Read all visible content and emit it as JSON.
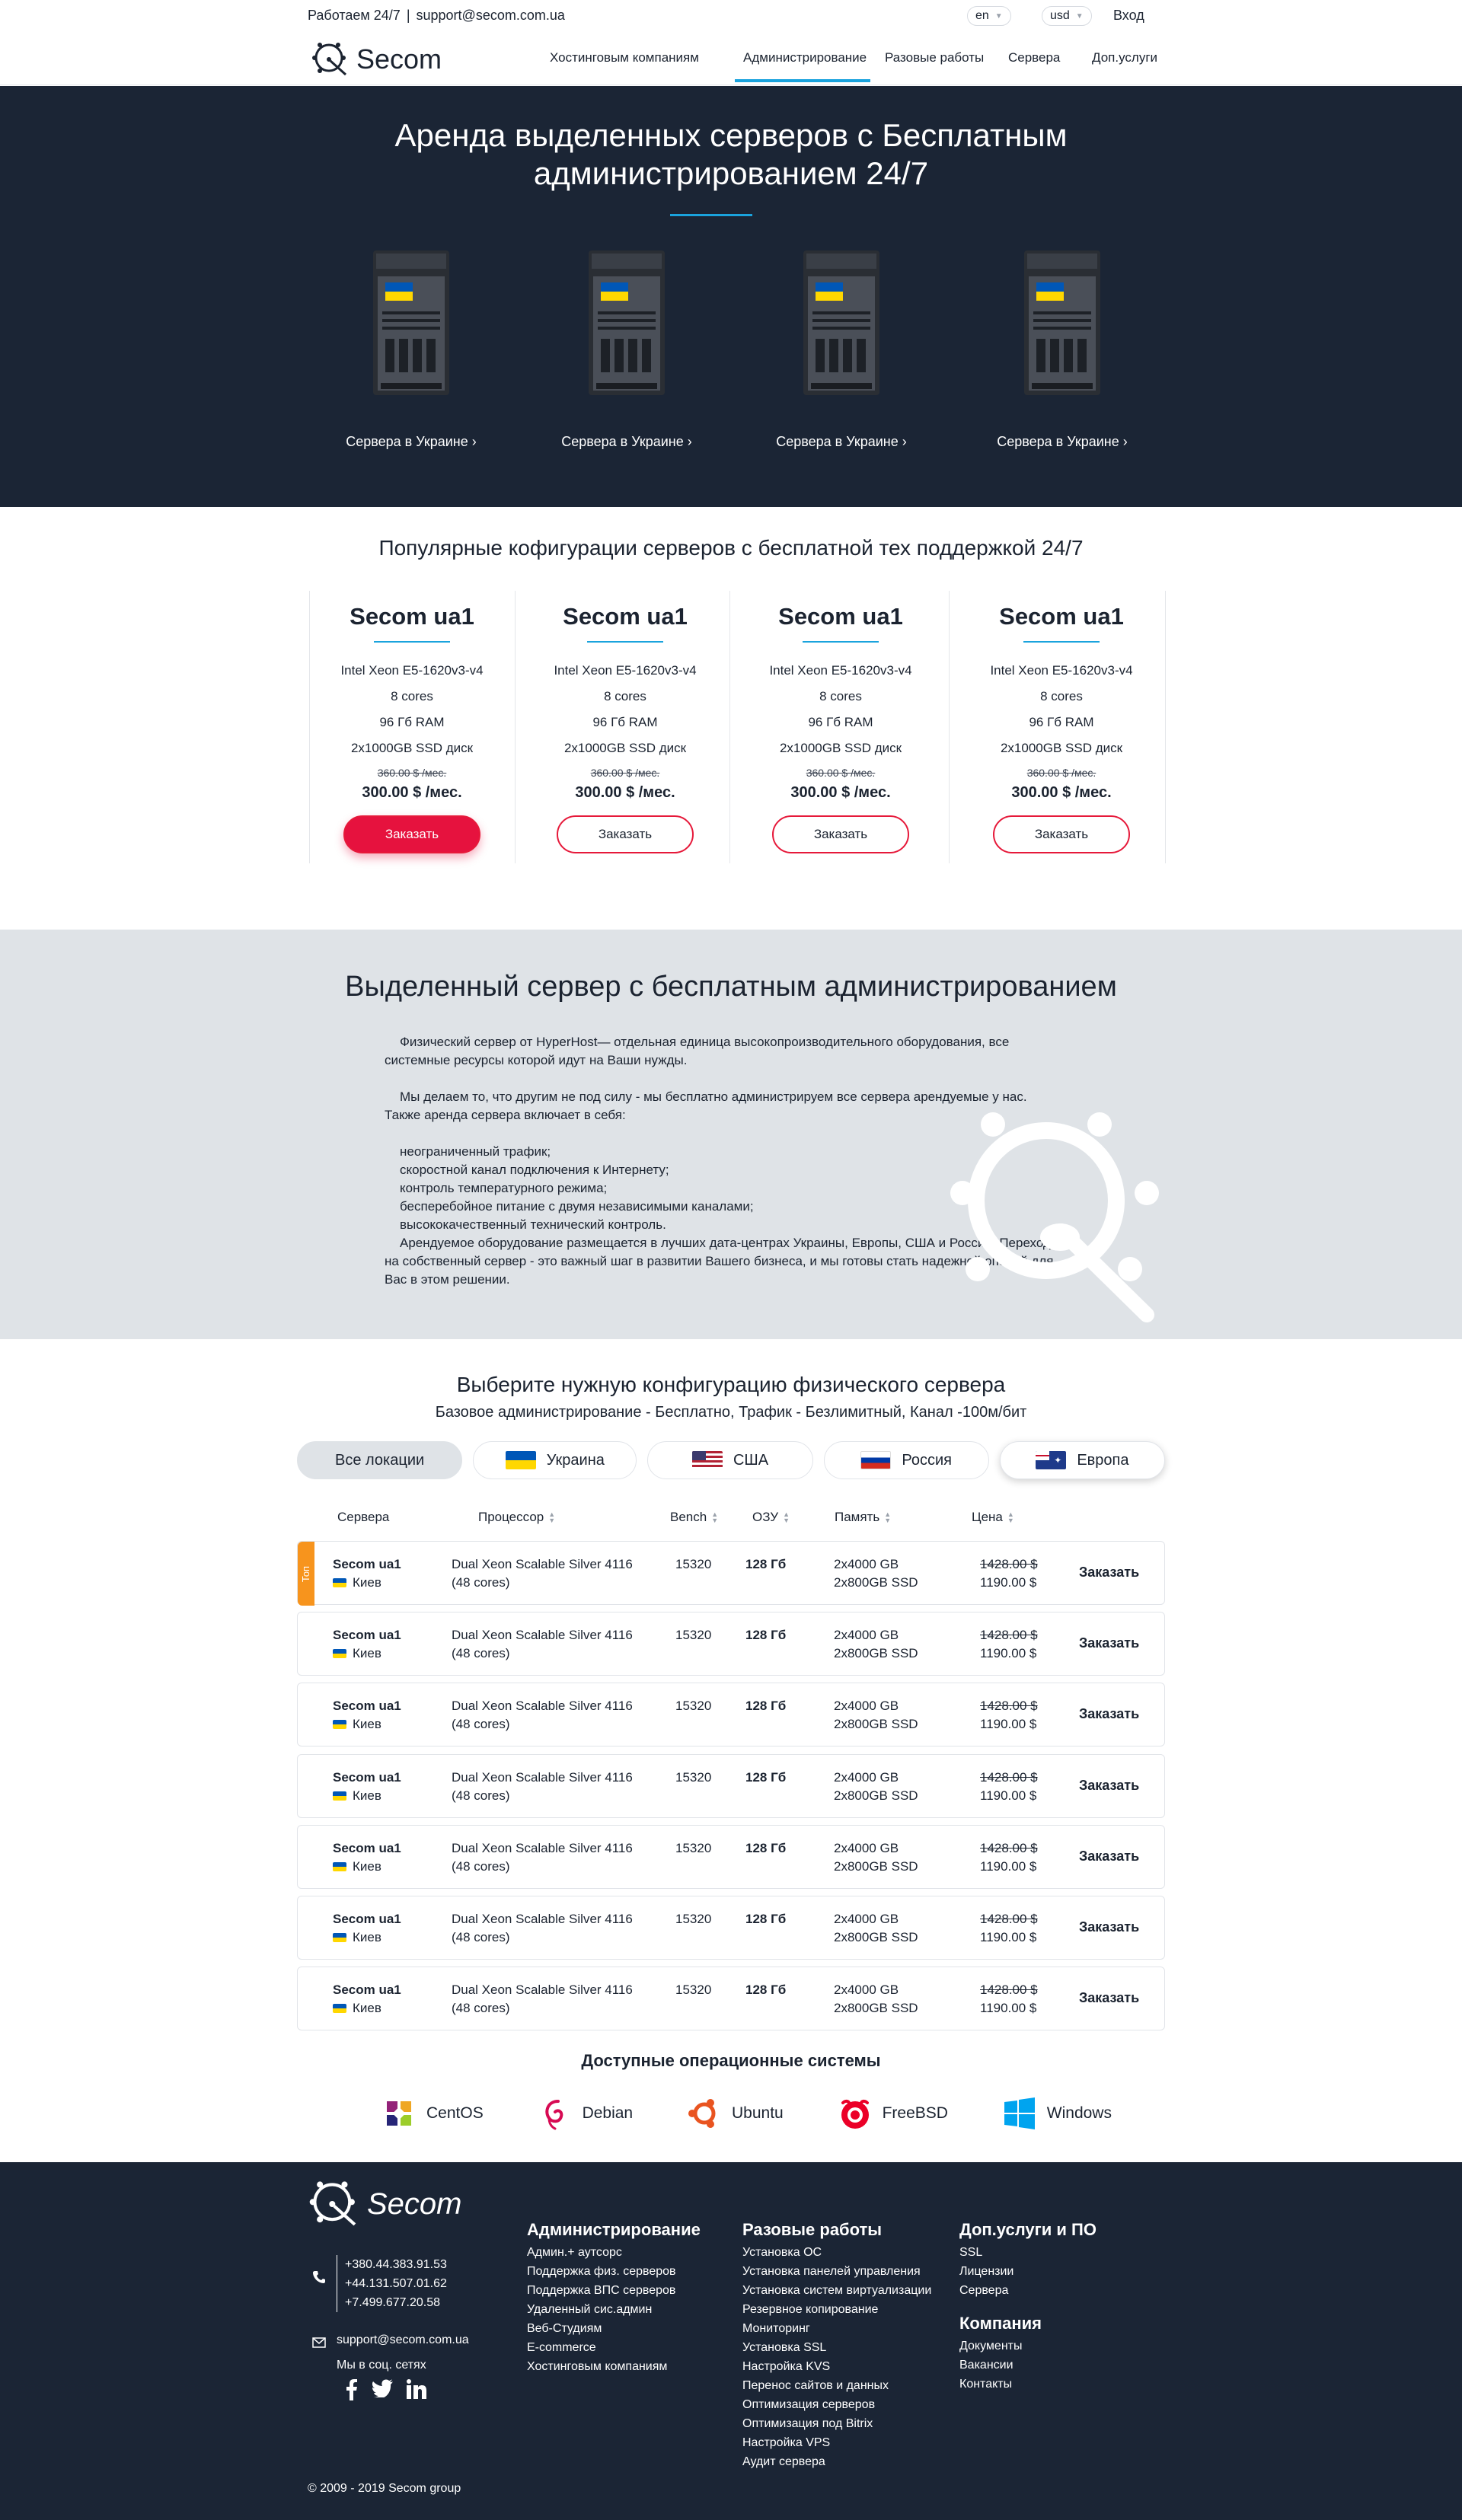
{
  "topbar": {
    "hours": "Работаем 24/7",
    "separator": "|",
    "email": "support@secom.com.ua",
    "lang": "en",
    "currency": "usd",
    "login": "Вход"
  },
  "brand": {
    "name": "Secom",
    "accent": "#1aa3dd",
    "danger": "#e6123e",
    "dark": "#1b2535"
  },
  "nav": {
    "items": [
      "Хостинговым компаниям",
      "Администрирование",
      "Разовые работы",
      "Сервера",
      "Доп.услуги"
    ],
    "active_index": 1
  },
  "hero": {
    "title_line1": "Аренда выделенных серверов с Бесплатным",
    "title_line2": "администрированием 24/7",
    "cards": [
      {
        "label": "Сервера в Украине ›"
      },
      {
        "label": "Сервера в Украине ›"
      },
      {
        "label": "Сервера в Украине ›"
      },
      {
        "label": "Сервера в Украине ›"
      }
    ]
  },
  "popular": {
    "title": "Популярные кофигурации серверов с бесплатной тех поддержкой 24/7",
    "plans": [
      {
        "name": "Secom ua1",
        "cpu": "Intel Xeon E5-1620v3-v4",
        "cores": "8 cores",
        "ram": "96 Гб RAM",
        "disk": "2x1000GB SSD диск",
        "old_price": "360.00 $ /мес.",
        "price": "300.00 $ /мес.",
        "button": "Заказать"
      },
      {
        "name": "Secom ua1",
        "cpu": "Intel Xeon E5-1620v3-v4",
        "cores": "8 cores",
        "ram": "96 Гб RAM",
        "disk": "2x1000GB SSD диск",
        "old_price": "360.00 $ /мес.",
        "price": "300.00 $ /мес.",
        "button": "Заказать"
      },
      {
        "name": "Secom ua1",
        "cpu": "Intel Xeon E5-1620v3-v4",
        "cores": "8 cores",
        "ram": "96 Гб RAM",
        "disk": "2x1000GB SSD диск",
        "old_price": "360.00 $ /мес.",
        "price": "300.00 $ /мес.",
        "button": "Заказать"
      },
      {
        "name": "Secom ua1",
        "cpu": "Intel Xeon E5-1620v3-v4",
        "cores": "8 cores",
        "ram": "96 Гб RAM",
        "disk": "2x1000GB SSD диск",
        "old_price": "360.00 $ /мес.",
        "price": "300.00 $ /мес.",
        "button": "Заказать"
      }
    ]
  },
  "info": {
    "title": "Выделенный сервер с бесплатным администрированием",
    "p1": "Физический сервер от HyperHost— отдельная единица высокопроизводительного оборудования, все системные ресурсы которой идут на Ваши нужды.",
    "p2": "Мы делаем то, что другим не под силу - мы бесплатно администрируем все сервера арендуемые у нас. Также аренда сервера включает в себя:",
    "list": [
      "неограниченный трафик;",
      "скоростной канал подключения к Интернету;",
      "контроль температурного режима;",
      "бесперебойное питание с двумя независимыми каналами;",
      "высококачественный технический контроль."
    ],
    "p3": "Арендуемое оборудование размещается в лучших дата-центрах Украины, Европы, США и России. Переход на собственный сервер - это важный шаг в развитии Вашего бизнеса, и мы готовы стать надежной опорой для Вас в этом решении."
  },
  "selector": {
    "title": "Выберите нужную конфигурацию физического сервера",
    "subtitle": "Базовое администрирование - Бесплатно, Трафик - Безлимитный, Канал -100м/бит",
    "locations": [
      {
        "label": "Все локации",
        "flag": ""
      },
      {
        "label": "Украина",
        "flag": "ua"
      },
      {
        "label": "США",
        "flag": "us"
      },
      {
        "label": "Россия",
        "flag": "ru"
      },
      {
        "label": "Европа",
        "flag": "eu"
      }
    ],
    "columns": [
      "Сервера",
      "Процессор",
      "Bench",
      "ОЗУ",
      "Память",
      "Цена"
    ],
    "badge": "Топ",
    "rows": [
      {
        "name": "Secom ua1",
        "city": "Киев",
        "cpu1": "Dual Xeon Scalable Silver 4116",
        "cpu2": "(48 cores)",
        "bench": "15320",
        "ram": "128 Гб",
        "disk1": "2x4000 GB",
        "disk2": "2x800GB SSD",
        "old": "1428.00 $",
        "price": "1190.00 $",
        "order": "Заказать"
      },
      {
        "name": "Secom ua1",
        "city": "Киев",
        "cpu1": "Dual Xeon Scalable Silver 4116",
        "cpu2": "(48 cores)",
        "bench": "15320",
        "ram": "128 Гб",
        "disk1": "2x4000 GB",
        "disk2": "2x800GB SSD",
        "old": "1428.00 $",
        "price": "1190.00 $",
        "order": "Заказать"
      },
      {
        "name": "Secom ua1",
        "city": "Киев",
        "cpu1": "Dual Xeon Scalable Silver 4116",
        "cpu2": "(48 cores)",
        "bench": "15320",
        "ram": "128 Гб",
        "disk1": "2x4000 GB",
        "disk2": "2x800GB SSD",
        "old": "1428.00 $",
        "price": "1190.00 $",
        "order": "Заказать"
      },
      {
        "name": "Secom ua1",
        "city": "Киев",
        "cpu1": "Dual Xeon Scalable Silver 4116",
        "cpu2": "(48 cores)",
        "bench": "15320",
        "ram": "128 Гб",
        "disk1": "2x4000 GB",
        "disk2": "2x800GB SSD",
        "old": "1428.00 $",
        "price": "1190.00 $",
        "order": "Заказать"
      },
      {
        "name": "Secom ua1",
        "city": "Киев",
        "cpu1": "Dual Xeon Scalable Silver 4116",
        "cpu2": "(48 cores)",
        "bench": "15320",
        "ram": "128 Гб",
        "disk1": "2x4000 GB",
        "disk2": "2x800GB SSD",
        "old": "1428.00 $",
        "price": "1190.00 $",
        "order": "Заказать"
      },
      {
        "name": "Secom ua1",
        "city": "Киев",
        "cpu1": "Dual Xeon Scalable Silver 4116",
        "cpu2": "(48 cores)",
        "bench": "15320",
        "ram": "128 Гб",
        "disk1": "2x4000 GB",
        "disk2": "2x800GB SSD",
        "old": "1428.00 $",
        "price": "1190.00 $",
        "order": "Заказать"
      },
      {
        "name": "Secom ua1",
        "city": "Киев",
        "cpu1": "Dual Xeon Scalable Silver 4116",
        "cpu2": "(48 cores)",
        "bench": "15320",
        "ram": "128 Гб",
        "disk1": "2x4000 GB",
        "disk2": "2x800GB SSD",
        "old": "1428.00 $",
        "price": "1190.00 $",
        "order": "Заказать"
      }
    ]
  },
  "os": {
    "title": "Доступные операционные системы",
    "items": [
      {
        "label": "CentOS",
        "icon": "centos-icon"
      },
      {
        "label": "Debian",
        "icon": "debian-icon"
      },
      {
        "label": "Ubuntu",
        "icon": "ubuntu-icon"
      },
      {
        "label": "FreeBSD",
        "icon": "freebsd-icon"
      },
      {
        "label": "Windows",
        "icon": "windows-icon"
      }
    ]
  },
  "footer": {
    "phones": [
      "+380.44.383.91.53",
      "+44.131.507.01.62",
      "+7.499.677.20.58"
    ],
    "email": "support@secom.com.ua",
    "social_label": "Мы в соц. сетях",
    "col1": {
      "title": "Администрирование",
      "items": [
        "Админ.+ аутсорс",
        "Поддержка физ. серверов",
        "Поддержка ВПС серверов",
        "Удаленный сис.админ",
        "Веб-Студиям",
        "E-commerce",
        "Хостинговым компаниям"
      ]
    },
    "col2": {
      "title": "Разовые работы",
      "items": [
        "Установка ОС",
        "Установка панелей управления",
        "Установка систем виртуализации",
        "Резервное копирование",
        "Мониторинг",
        "Установка SSL",
        "Настройка KVS",
        "Перенос сайтов и данных",
        "Оптимизация серверов",
        "Оптимизация под Bitrix",
        "Настройка VPS",
        "Аудит сервера"
      ]
    },
    "col3": {
      "title": "Доп.услуги и ПО",
      "items": [
        "SSL",
        "Лицензии",
        "Сервера"
      ]
    },
    "col4": {
      "title": "Компания",
      "items": [
        "Документы",
        "Вакансии",
        "Контакты"
      ]
    },
    "copyright": "© 2009 - 2019 Secom group"
  }
}
